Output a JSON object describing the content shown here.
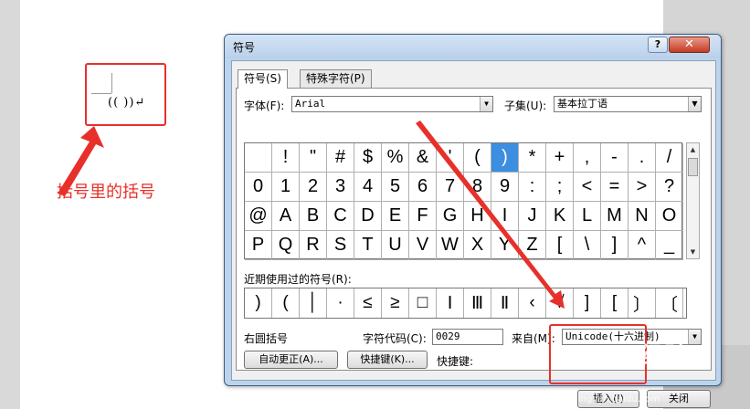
{
  "document": {
    "text": "((  ))↵",
    "annotation": "括号里的括号"
  },
  "dialog": {
    "title": "符号",
    "help": "?",
    "close": "✕",
    "tabs": [
      {
        "label": "符号(S)"
      },
      {
        "label": "特殊字符(P)"
      }
    ],
    "font_label": "字体(F):",
    "font_value": "Arial",
    "subset_label": "子集(U):",
    "subset_value": "基本拉丁语",
    "grid": [
      [
        "",
        "!",
        "\"",
        "#",
        "$",
        "%",
        "&",
        "'",
        "(",
        ")",
        "*",
        "+",
        ",",
        "-",
        ".",
        "/"
      ],
      [
        "0",
        "1",
        "2",
        "3",
        "4",
        "5",
        "6",
        "7",
        "8",
        "9",
        ":",
        ";",
        "<",
        "=",
        ">",
        "?"
      ],
      [
        "@",
        "A",
        "B",
        "C",
        "D",
        "E",
        "F",
        "G",
        "H",
        "I",
        "J",
        "K",
        "L",
        "M",
        "N",
        "O"
      ],
      [
        "P",
        "Q",
        "R",
        "S",
        "T",
        "U",
        "V",
        "W",
        "X",
        "Y",
        "Z",
        "[",
        "\\",
        "]",
        "^",
        "_"
      ]
    ],
    "selected_symbol": ")",
    "recent_label": "近期使用过的符号(R):",
    "recent_symbols": [
      ")",
      "(",
      "│",
      "·",
      "≤",
      "≥",
      "□",
      "Ⅰ",
      "Ⅲ",
      "Ⅱ",
      "‹",
      "√",
      "]",
      "[",
      "〕",
      "〔"
    ],
    "char_name": "右圆括号",
    "char_code_label": "字符代码(C):",
    "char_code_value": "0029",
    "from_label": "来自(M):",
    "from_value": "Unicode(十六进制)",
    "autocorrect_btn": "自动更正(A)...",
    "shortcut_btn": "快捷键(K)...",
    "shortcut_label": "快捷键:",
    "insert_btn": "插入(I)",
    "cancel_btn": "关闭"
  },
  "watermark": {
    "brand": "Baidu经验",
    "url": "jingyan.baidu.com"
  },
  "colors": {
    "annotation_red": "#e8302a",
    "selection_blue": "#3c8ee0"
  }
}
